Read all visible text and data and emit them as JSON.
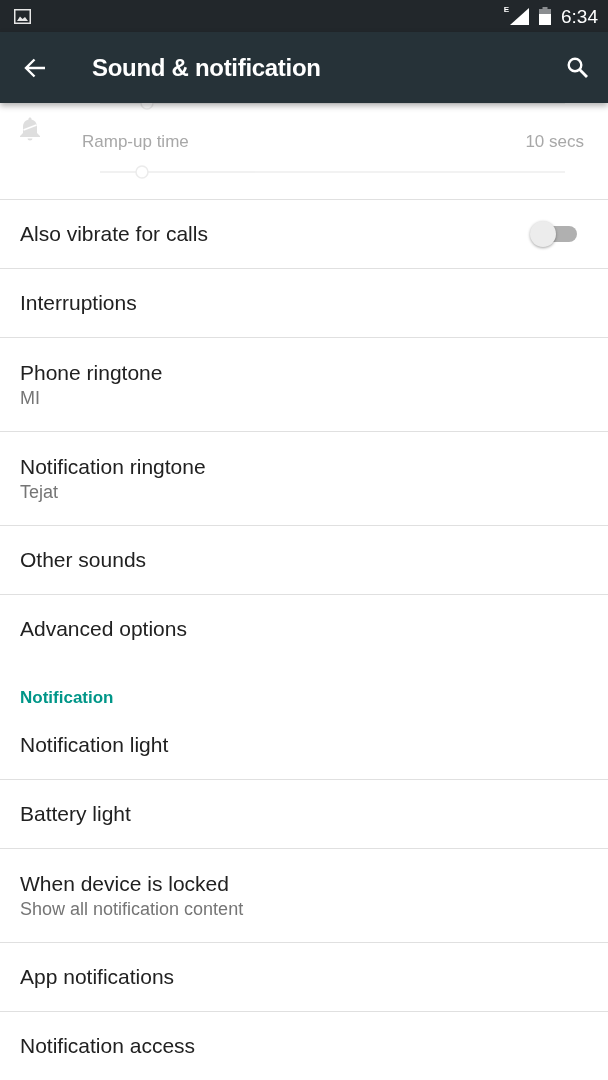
{
  "status_bar": {
    "network_type": "E",
    "time": "6:34"
  },
  "app_bar": {
    "title": "Sound & notification"
  },
  "volume_section": {
    "dimmed": true,
    "partial_slider": {
      "level": 0.1
    },
    "ramp_up": {
      "label": "Ramp-up time",
      "value": "10 secs",
      "level": 0.09
    }
  },
  "sections": [
    {
      "items": [
        {
          "kind": "switch",
          "title": "Also vibrate for calls",
          "on": false
        },
        {
          "kind": "plain",
          "title": "Interruptions"
        },
        {
          "kind": "plain",
          "title": "Phone ringtone",
          "summary": "MI"
        },
        {
          "kind": "plain",
          "title": "Notification ringtone",
          "summary": "Tejat"
        },
        {
          "kind": "plain",
          "title": "Other sounds"
        },
        {
          "kind": "plain",
          "title": "Advanced options"
        }
      ]
    },
    {
      "header": "Notification",
      "items": [
        {
          "kind": "plain",
          "title": "Notification light"
        },
        {
          "kind": "plain",
          "title": "Battery light"
        },
        {
          "kind": "plain",
          "title": "When device is locked",
          "summary": "Show all notification content"
        },
        {
          "kind": "plain",
          "title": "App notifications"
        },
        {
          "kind": "plain",
          "title": "Notification access"
        }
      ]
    }
  ]
}
